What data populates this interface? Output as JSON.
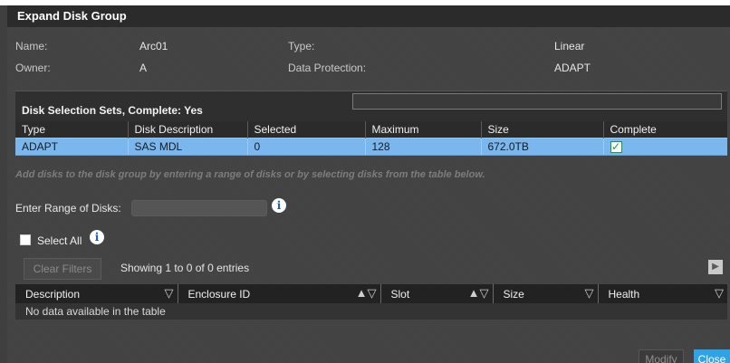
{
  "dialog": {
    "title": "Expand Disk Group"
  },
  "details": {
    "name_label": "Name:",
    "name_value": "Arc01",
    "owner_label": "Owner:",
    "owner_value": "A",
    "type_label": "Type:",
    "type_value": "Linear",
    "protection_label": "Data Protection:",
    "protection_value": "ADAPT"
  },
  "sets": {
    "title": "Disk Selection Sets, Complete: Yes",
    "columns": [
      "Type",
      "Disk Description",
      "Selected",
      "Maximum",
      "Size",
      "Complete"
    ],
    "row": {
      "type": "ADAPT",
      "description": "SAS MDL",
      "selected": "0",
      "maximum": "128",
      "size": "672.0TB",
      "complete": "✓"
    }
  },
  "hint": "Add disks to the disk group by entering a range of disks or by selecting disks from the table below.",
  "range": {
    "label": "Enter Range of Disks:",
    "value": ""
  },
  "select_all": {
    "label": "Select All",
    "checked": false
  },
  "filters": {
    "clear_label": "Clear Filters",
    "showing": "Showing 1 to 0 of 0 entries"
  },
  "disk_table": {
    "columns": [
      "Description",
      "Enclosure ID",
      "Slot",
      "Size",
      "Health"
    ],
    "empty": "No data available in the table"
  },
  "buttons": {
    "modify": "Modify",
    "close": "Close"
  },
  "icons": {
    "info": "info-icon",
    "filter": "filter-icon",
    "sort": "sort-asc-icon",
    "export": "export-icon",
    "check": "check-icon"
  },
  "colors": {
    "selected_row": "#79b7ee",
    "close_button": "#2ea4e6",
    "check_green": "#1b9c3a"
  }
}
